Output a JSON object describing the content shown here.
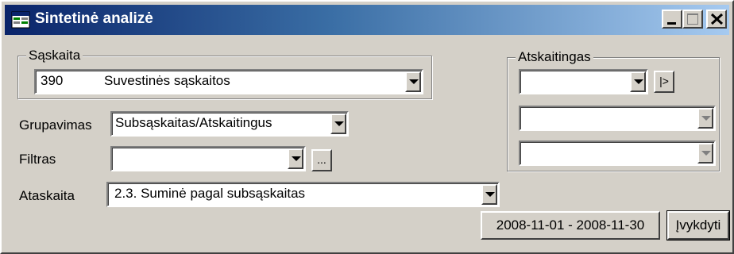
{
  "window": {
    "title": "Sintetinė analizė"
  },
  "account_group": {
    "legend": "Sąskaita",
    "code": "390",
    "name": "Suvestinės sąskaitos"
  },
  "grouping": {
    "label": "Grupavimas",
    "value": "Subsąskaitas/Atskaitingus"
  },
  "filter": {
    "label": "Filtras",
    "value": "",
    "browse_label": "..."
  },
  "report": {
    "label": "Ataskaita",
    "value": "2.3. Suminė pagal subsąskaitas"
  },
  "accountable_group": {
    "legend": "Atskaitingas",
    "value_1": "",
    "value_2": "",
    "value_3": "",
    "next_label": "|>"
  },
  "footer": {
    "date_range": "2008-11-01 - 2008-11-30",
    "execute_label": "Įvykdyti"
  },
  "colors": {
    "face": "#d4d0c8",
    "title_start": "#0a246a",
    "title_end": "#a6caf0"
  }
}
